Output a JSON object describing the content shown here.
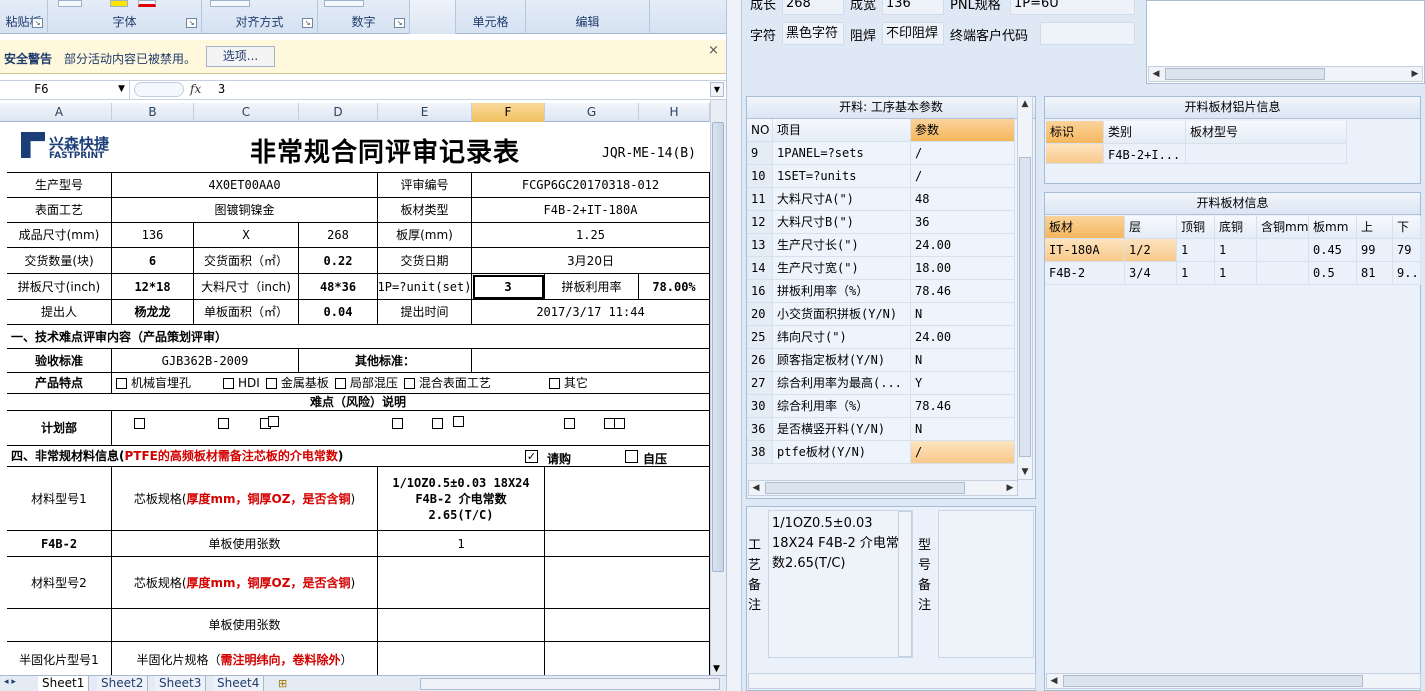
{
  "excel": {
    "ribbon": {
      "groups": [
        "粘贴板",
        "字体",
        "对齐方式",
        "数字",
        "",
        "单元格",
        "编辑"
      ]
    },
    "warning": {
      "title": "安全警告",
      "message": "部分活动内容已被禁用。",
      "options_label": "选项...",
      "close": "×"
    },
    "name_box": "F6",
    "fx": "fx",
    "formula_value": "3",
    "columns": [
      "A",
      "B",
      "C",
      "D",
      "E",
      "F",
      "G",
      "H"
    ],
    "selected_column": "F",
    "sheet": {
      "logo_cn": "兴森快捷",
      "logo_en": "FASTPRINT",
      "title": "非常规合同评审记录表",
      "code": "JQR-ME-14(B)",
      "r1": {
        "l1": "生产型号",
        "v1": "4X0ET00AA0",
        "l2": "评审编号",
        "v2": "FCGP6GC20170318-012"
      },
      "r2": {
        "l1": "表面工艺",
        "v1": "图镀铜镍金",
        "l2": "板材类型",
        "v2": "F4B-2+IT-180A"
      },
      "r3": {
        "l1": "成品尺寸(mm)",
        "v1": "136",
        "v2": "X",
        "v3": "268",
        "l2": "板厚(mm)",
        "v4": "1.25"
      },
      "r4": {
        "l1": "交货数量(块)",
        "v1": "6",
        "l2": "交货面积（㎡）",
        "v2": "0.22",
        "l3": "交货日期",
        "v3": "3月20日"
      },
      "r5": {
        "l1": "拼板尺寸(inch)",
        "v1": "12*18",
        "l2": "大料尺寸（inch)",
        "v2": "48*36",
        "l3": "1P=?unit(set)",
        "v3": "3",
        "l4": "拼板利用率",
        "v4": "78.00%"
      },
      "r6": {
        "l1": "提出人",
        "v1": "杨龙龙",
        "l2": "单板面积（㎡）",
        "v2": "0.04",
        "l3": "提出时间",
        "v3": "2017/3/17 11:44"
      },
      "sec1": "一、技术难点评审内容（产品策划评审）",
      "r8": {
        "l1": "验收标准",
        "v1": "GJB362B-2009",
        "l2": "其他标准："
      },
      "r9": {
        "l1": "产品特点",
        "items": [
          "机械盲埋孔",
          "HDI",
          "金属基板",
          "局部混压",
          "混合表面工艺",
          "其它"
        ]
      },
      "r10": "难点（风险）说明",
      "r11": "计划部",
      "sec4_a": "四、非常规材料信息(",
      "sec4_b": "PTFE的高频板材需备注芯板的介电常数",
      "sec4_c": ")",
      "purchase": "请购",
      "self_buy": "自压",
      "check_mark": "✓",
      "m1": {
        "l1": "材料型号1",
        "l2a": "芯板规格(",
        "l2b": "厚度mm，铜厚OZ，是否含铜",
        "l2c": ")",
        "v": "1/1OZ0.5±0.03 18X24 F4B-2 介电常数 2.65(T/C)"
      },
      "m2": {
        "l1": "F4B-2",
        "l2": "单板使用张数",
        "v": "1"
      },
      "m3": {
        "l1": "材料型号2",
        "l2a": "芯板规格(",
        "l2b": "厚度mm，铜厚OZ，是否含铜",
        "l2c": ")"
      },
      "m4": {
        "l2": "单板使用张数"
      },
      "m5": {
        "l1": "半固化片型号1",
        "l2a": "半固化片规格（",
        "l2b": "需注明纬向，卷料除外",
        "l2c": "）"
      }
    },
    "tabs": [
      "Sheet1",
      "Sheet2",
      "Sheet3",
      "Sheet4"
    ]
  },
  "app": {
    "top_fields": {
      "l_chengchang": "成长",
      "v_chengchang": "268",
      "l_chengkuan": "成宽",
      "v_chengkuan": "136",
      "l_pnl": "PNL规格",
      "v_pnl": "1P=6U",
      "l_zifu": "字符",
      "v_zifu": "黑色字符",
      "l_zuhan": "阻焊",
      "v_zuhan": "不印阻焊",
      "l_customer": "终端客户代码",
      "v_customer": ""
    },
    "params": {
      "title": "开料: 工序基本参数",
      "col_no": "NO",
      "col_item": "项目",
      "col_param": "参数",
      "rows": [
        {
          "no": "9",
          "item": "1PANEL=?sets",
          "param": "/"
        },
        {
          "no": "10",
          "item": "1SET=?units",
          "param": "/"
        },
        {
          "no": "11",
          "item": "大料尺寸A(\")",
          "param": "48"
        },
        {
          "no": "12",
          "item": "大料尺寸B(\")",
          "param": "36"
        },
        {
          "no": "13",
          "item": "生产尺寸长(\")",
          "param": "24.00"
        },
        {
          "no": "14",
          "item": "生产尺寸宽(\")",
          "param": "18.00"
        },
        {
          "no": "16",
          "item": "拼板利用率（%）",
          "param": "78.46"
        },
        {
          "no": "20",
          "item": "小交货面积拼板(Y/N)",
          "param": "N"
        },
        {
          "no": "25",
          "item": "纬向尺寸(\")",
          "param": "24.00"
        },
        {
          "no": "26",
          "item": "顾客指定板材(Y/N)",
          "param": "N"
        },
        {
          "no": "27",
          "item": "综合利用率为最高(...",
          "param": "Y"
        },
        {
          "no": "30",
          "item": "综合利用率（%）",
          "param": "78.46"
        },
        {
          "no": "36",
          "item": "是否横竖开料(Y/N)",
          "param": "N"
        },
        {
          "no": "38",
          "item": "ptfe板材(Y/N)",
          "param": "/"
        }
      ]
    },
    "memo": {
      "label": "工艺备注",
      "text": "1/1OZ0.5±0.03 18X24 F4B-2 介电常数2.65(T/C)",
      "label2": "型号备注"
    },
    "sheet_info": {
      "title": "开料板材铝片信息",
      "cols": [
        "标识",
        "类别",
        "板材型号"
      ],
      "row": [
        "",
        "F4B-2+I...",
        ""
      ]
    },
    "board_info": {
      "title": "开料板材信息",
      "cols": [
        "板材",
        "层",
        "顶铜",
        "底铜",
        "含铜mm",
        "板mm",
        "上",
        "下"
      ],
      "rows": [
        [
          "IT-180A",
          "1/2",
          "1",
          "1",
          "",
          "0.45",
          "99",
          "79"
        ],
        [
          "F4B-2",
          "3/4",
          "1",
          "1",
          "",
          "0.5",
          "81",
          "9..."
        ]
      ]
    }
  }
}
